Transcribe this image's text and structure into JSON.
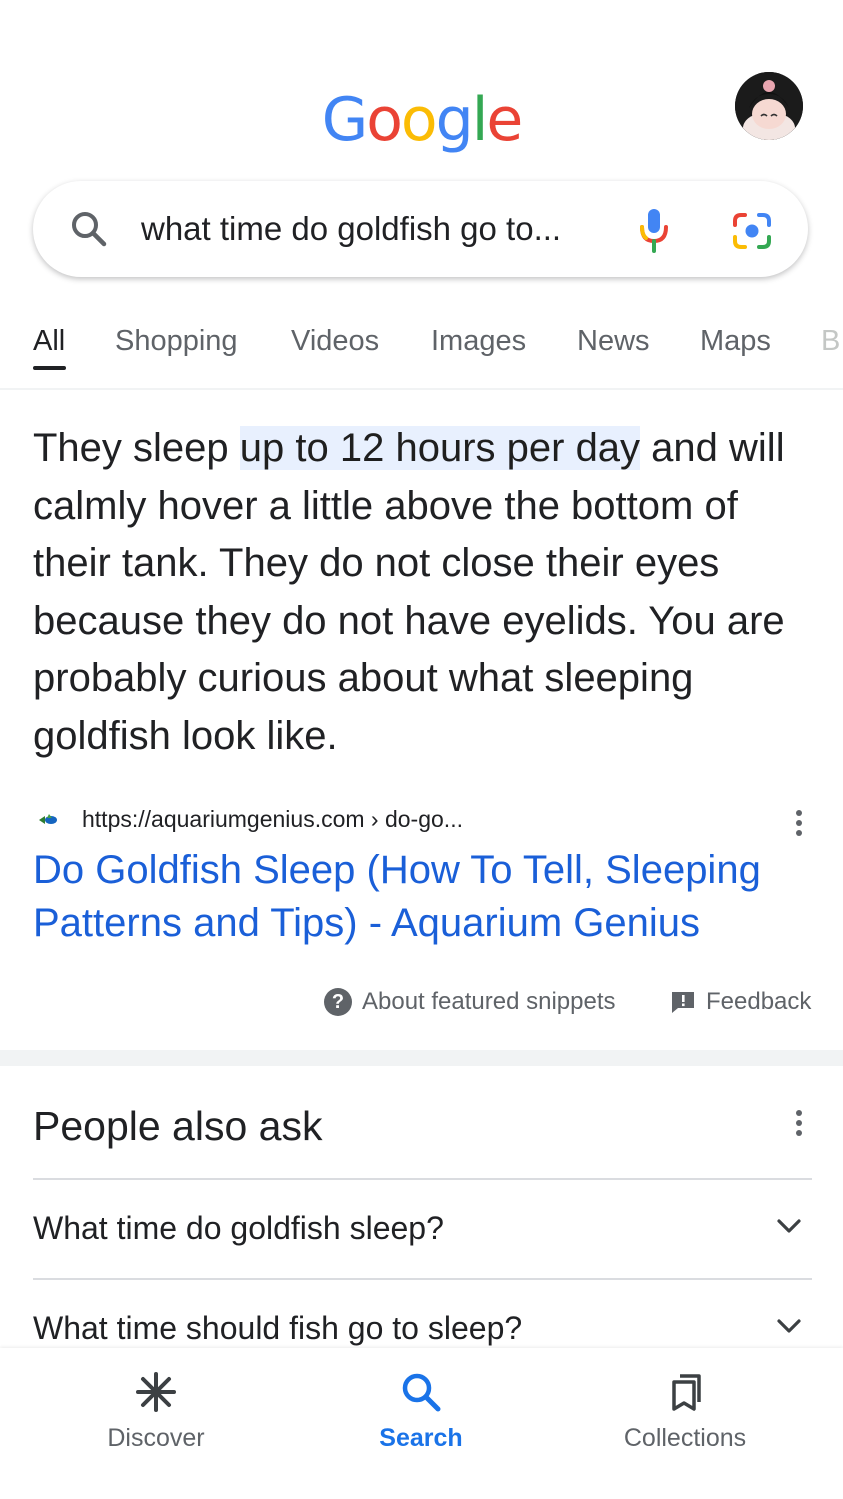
{
  "header": {
    "logo_letters": [
      {
        "ch": "G",
        "color": "#4285F4"
      },
      {
        "ch": "o",
        "color": "#EA4335"
      },
      {
        "ch": "o",
        "color": "#FBBC05"
      },
      {
        "ch": "g",
        "color": "#4285F4"
      },
      {
        "ch": "l",
        "color": "#34A853"
      },
      {
        "ch": "e",
        "color": "#EA4335"
      }
    ]
  },
  "search": {
    "query": "what time do goldfish go to..."
  },
  "tabs": [
    "All",
    "Shopping",
    "Videos",
    "Images",
    "News",
    "Maps",
    "B"
  ],
  "snippet": {
    "before": "They sleep ",
    "highlight": "up to 12 hours per day",
    "after": " and will calmly hover a little above the bottom of their tank. They do not close their eyes because they do not have eyelids. You are probably curious about what sleeping goldfish look like."
  },
  "source": {
    "url": "https://aquariumgenius.com › do-go...",
    "title": "Do Goldfish Sleep (How To Tell, Sleeping Patterns and Tips) - Aquarium Genius"
  },
  "snippet_footer": {
    "about": "About featured snippets",
    "feedback": "Feedback"
  },
  "people_also_ask": {
    "title": "People also ask",
    "questions": [
      "What time do goldfish sleep?",
      "What time should fish go to sleep?"
    ]
  },
  "bottom_nav": {
    "discover": "Discover",
    "search": "Search",
    "collections": "Collections"
  },
  "colors": {
    "link_blue": "#1a5fd8",
    "active_blue": "#1a73e8",
    "highlight_bg": "#e8f0fe"
  }
}
